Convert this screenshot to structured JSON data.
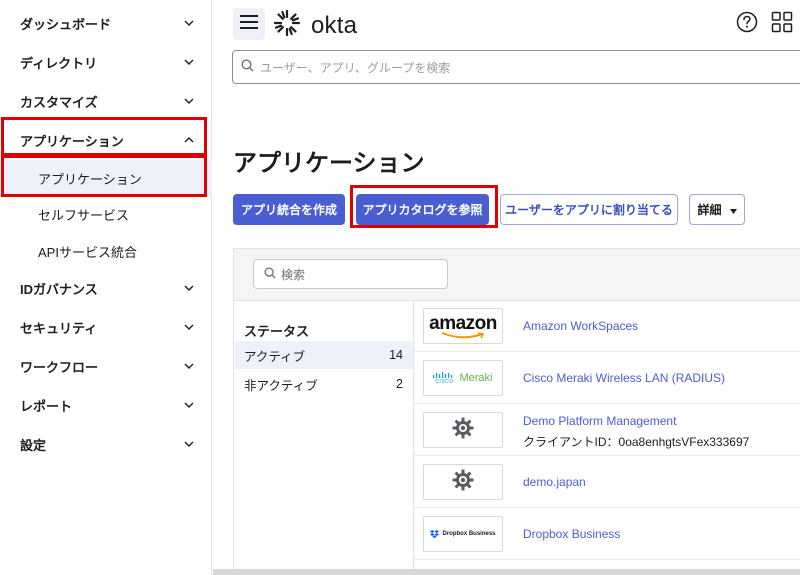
{
  "brand": {
    "name": "okta",
    "accent": "#4a5ed1",
    "highlight": "#e00000"
  },
  "sidebar": {
    "items": [
      {
        "label": "ダッシュボード",
        "expanded": false
      },
      {
        "label": "ディレクトリ",
        "expanded": false
      },
      {
        "label": "カスタマイズ",
        "expanded": false
      },
      {
        "label": "アプリケーション",
        "expanded": true
      },
      {
        "label": "IDガバナンス",
        "expanded": false
      },
      {
        "label": "セキュリティ",
        "expanded": false
      },
      {
        "label": "ワークフロー",
        "expanded": false
      },
      {
        "label": "レポート",
        "expanded": false
      },
      {
        "label": "設定",
        "expanded": false
      }
    ],
    "subitems": [
      {
        "label": "アプリケーション",
        "active": true
      },
      {
        "label": "セルフサービス",
        "active": false
      },
      {
        "label": "APIサービス統合",
        "active": false
      }
    ]
  },
  "header": {
    "search_placeholder": "ユーザー、アプリ、グループを検索",
    "icons": [
      "menu-icon",
      "help-icon",
      "apps-grid-icon"
    ]
  },
  "main": {
    "title": "アプリケーション",
    "buttons": {
      "create": "アプリ統合を作成",
      "browse": "アプリカタログを参照",
      "assign": "ユーザーをアプリに割り当てる",
      "more": "詳細"
    },
    "search_placeholder": "検索",
    "filters": {
      "heading": "ステータス",
      "rows": [
        {
          "label": "アクティブ",
          "count": "14"
        },
        {
          "label": "非アクティブ",
          "count": "2"
        }
      ]
    },
    "apps": [
      {
        "name": "Amazon WorkSpaces",
        "logo": "amazon",
        "logo_text": "amazon",
        "sub": ""
      },
      {
        "name": "Cisco Meraki Wireless LAN (RADIUS)",
        "logo": "cisco-meraki",
        "logo_text": "Meraki",
        "logo_small": "CISCO",
        "sub": ""
      },
      {
        "name": "Demo Platform Management",
        "logo": "gear",
        "sub": "クライアントID：0oa8enhgtsVFex333697"
      },
      {
        "name": "demo.japan",
        "logo": "gear",
        "sub": ""
      },
      {
        "name": "Dropbox Business",
        "logo": "dropbox",
        "logo_text": "Dropbox Business",
        "sub": ""
      }
    ]
  }
}
